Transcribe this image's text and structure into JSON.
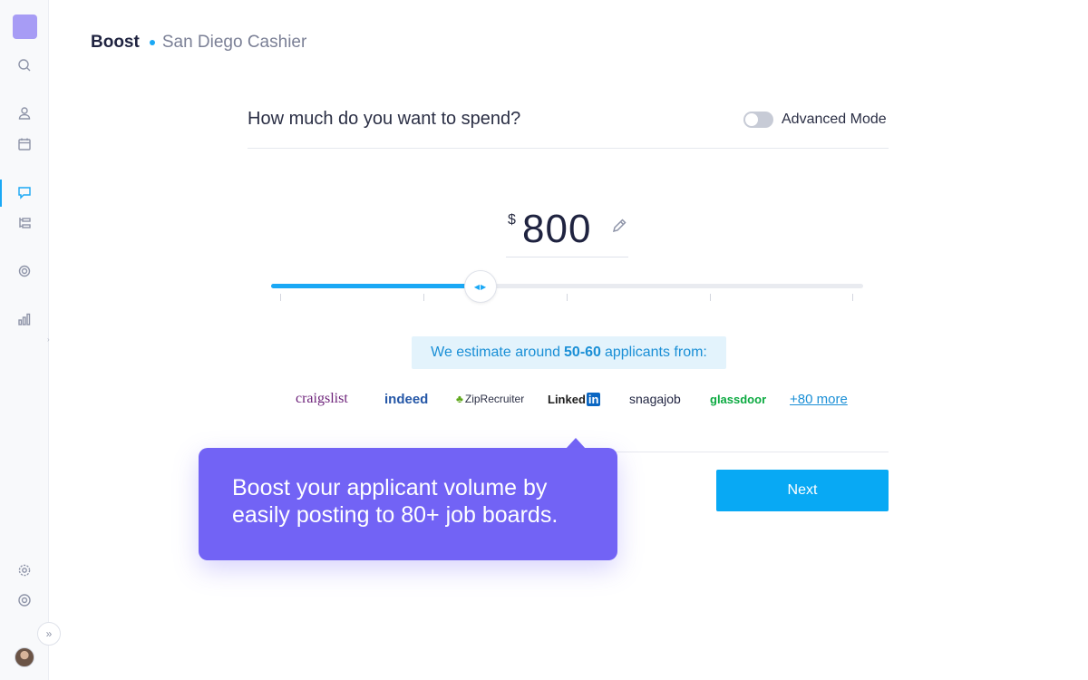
{
  "sidebar": {
    "icons": [
      "search-icon",
      "user-icon",
      "calendar-icon",
      "chat-icon",
      "hierarchy-icon",
      "badge-icon",
      "chart-icon",
      "settings-icon",
      "help-icon"
    ],
    "active": "chat-icon",
    "collapse_glyph": "»"
  },
  "header": {
    "title": "Boost",
    "subtitle": "San Diego Cashier"
  },
  "spend": {
    "question": "How much do you want to spend?",
    "advanced_mode_label": "Advanced Mode",
    "advanced_mode_on": false,
    "currency_symbol": "$",
    "amount": "800",
    "slider_fraction": 0.35
  },
  "estimate": {
    "prefix": "We estimate around",
    "range": "50-60",
    "suffix": "applicants from:"
  },
  "job_boards": {
    "craigslist": "craigslist",
    "indeed": "indeed",
    "ziprecruiter": "ZipRecruiter",
    "linkedin_text": "Linked",
    "linkedin_in": "in",
    "snagajob": "snagajob",
    "glassdoor": "glassdoor",
    "more": "+80 more"
  },
  "actions": {
    "next": "Next"
  },
  "tooltip": {
    "text": "Boost your applicant volume by easily posting to 80+ job boards."
  },
  "colors": {
    "accent": "#1aa8f5",
    "tooltip": "#7263f5",
    "logo": "#a79cf5"
  }
}
